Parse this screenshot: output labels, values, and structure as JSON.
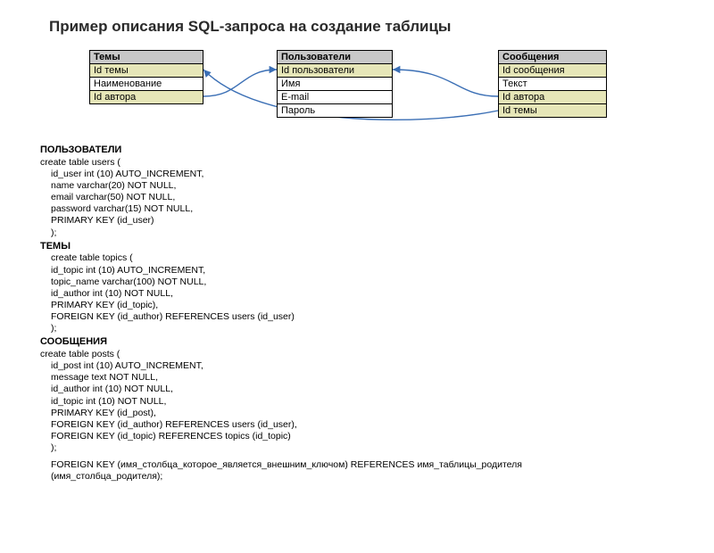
{
  "title": "Пример описания SQL-запроса на создание таблицы",
  "diagram": {
    "tables": {
      "topics": {
        "header": "Темы",
        "rows": [
          "Id темы",
          "Наименование",
          "Id автора"
        ]
      },
      "users": {
        "header": "Пользователи",
        "rows": [
          "Id пользователи",
          "Имя",
          "E-mail",
          "Пароль"
        ]
      },
      "posts": {
        "header": "Сообщения",
        "rows": [
          "Id сообщения",
          "Текст",
          "Id автора",
          "Id темы"
        ]
      }
    }
  },
  "sql": {
    "users": {
      "heading": "ПОЛЬЗОВАТЕЛИ",
      "lines": [
        "create table users (",
        "id_user int (10) AUTO_INCREMENT,",
        "name varchar(20) NOT NULL,",
        "email varchar(50) NOT NULL,",
        "password varchar(15) NOT NULL,",
        "PRIMARY KEY (id_user)",
        ");"
      ]
    },
    "topics": {
      "heading": "ТЕМЫ",
      "lines": [
        "create table topics (",
        "id_topic int (10) AUTO_INCREMENT,",
        "topic_name varchar(100) NOT NULL,",
        "id_author int (10) NOT NULL,",
        "PRIMARY KEY (id_topic),",
        "FOREIGN KEY (id_author) REFERENCES users (id_user)",
        ");"
      ]
    },
    "posts": {
      "heading": "СООБЩЕНИЯ",
      "lines": [
        "create table posts (",
        "id_post int (10) AUTO_INCREMENT,",
        "message text NOT NULL,",
        "id_author int (10) NOT NULL,",
        "id_topic int (10) NOT NULL,",
        "PRIMARY KEY (id_post),",
        "FOREIGN KEY (id_author) REFERENCES users (id_user),",
        "FOREIGN KEY (id_topic) REFERENCES topics (id_topic)",
        ");"
      ]
    }
  },
  "footer": "FOREIGN KEY (имя_столбца_которое_является_внешним_ключом) REFERENCES имя_таблицы_родителя (имя_столбца_родителя);"
}
